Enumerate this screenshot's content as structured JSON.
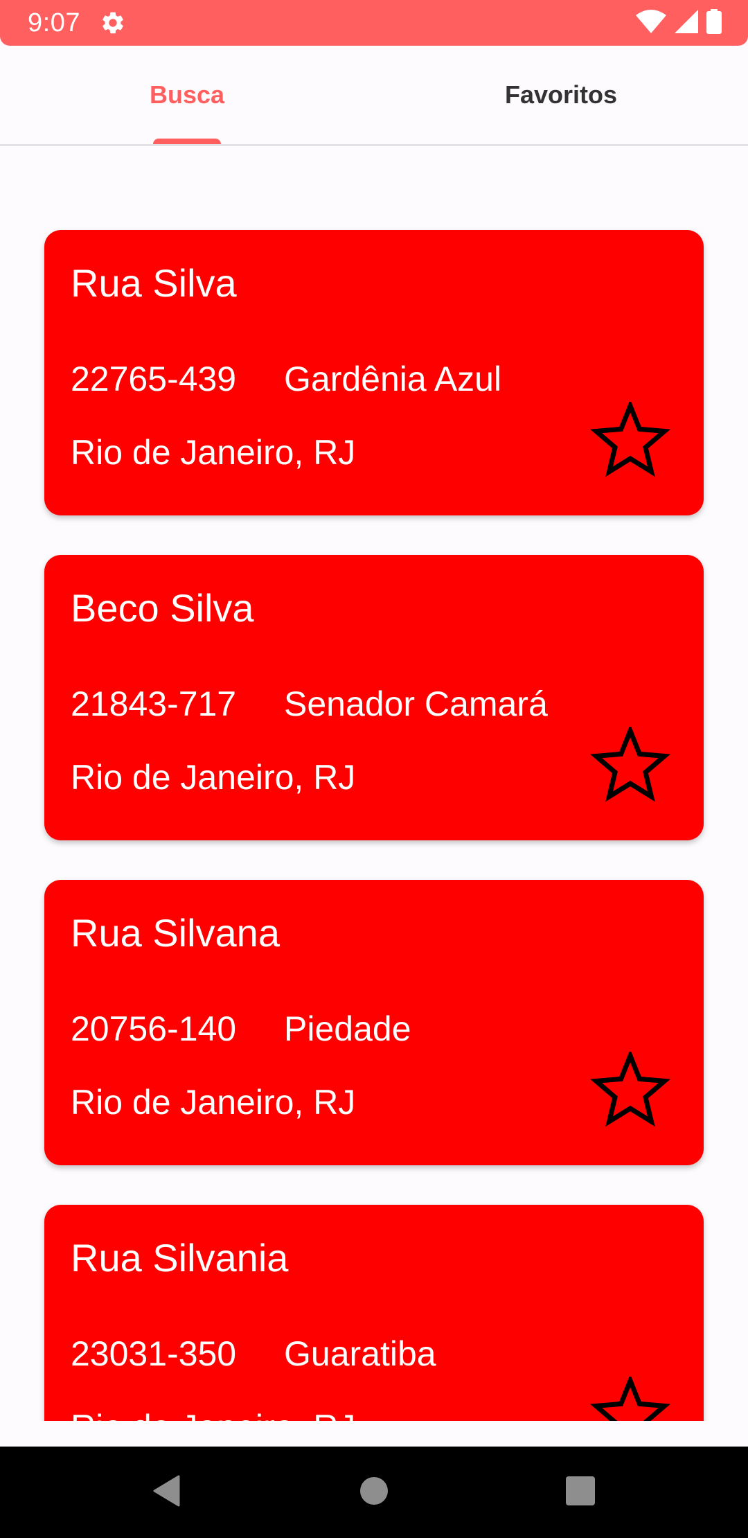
{
  "status_bar": {
    "time": "9:07",
    "background_color": "#ff5f5f",
    "icons": [
      "settings-icon",
      "wifi-icon",
      "signal-icon",
      "battery-icon"
    ]
  },
  "tabs": [
    {
      "label": "Busca",
      "selected": true
    },
    {
      "label": "Favoritos",
      "selected": false
    }
  ],
  "accent_color": "#ff5f5f",
  "card_color": "#ff0000",
  "results": [
    {
      "street": "Rua Silva",
      "cep": "22765-439",
      "neighborhood": "Gardênia Azul",
      "city": "Rio de Janeiro, RJ",
      "favorite": false
    },
    {
      "street": "Beco Silva",
      "cep": "21843-717",
      "neighborhood": "Senador Camará",
      "city": "Rio de Janeiro, RJ",
      "favorite": false
    },
    {
      "street": "Rua Silvana",
      "cep": "20756-140",
      "neighborhood": "Piedade",
      "city": "Rio de Janeiro, RJ",
      "favorite": false
    },
    {
      "street": "Rua Silvania",
      "cep": "23031-350",
      "neighborhood": "Guaratiba",
      "city": "Rio de Janeiro, RJ",
      "favorite": false
    }
  ],
  "nav_bar": {
    "icons": [
      "back-icon",
      "home-icon",
      "recents-icon"
    ]
  }
}
